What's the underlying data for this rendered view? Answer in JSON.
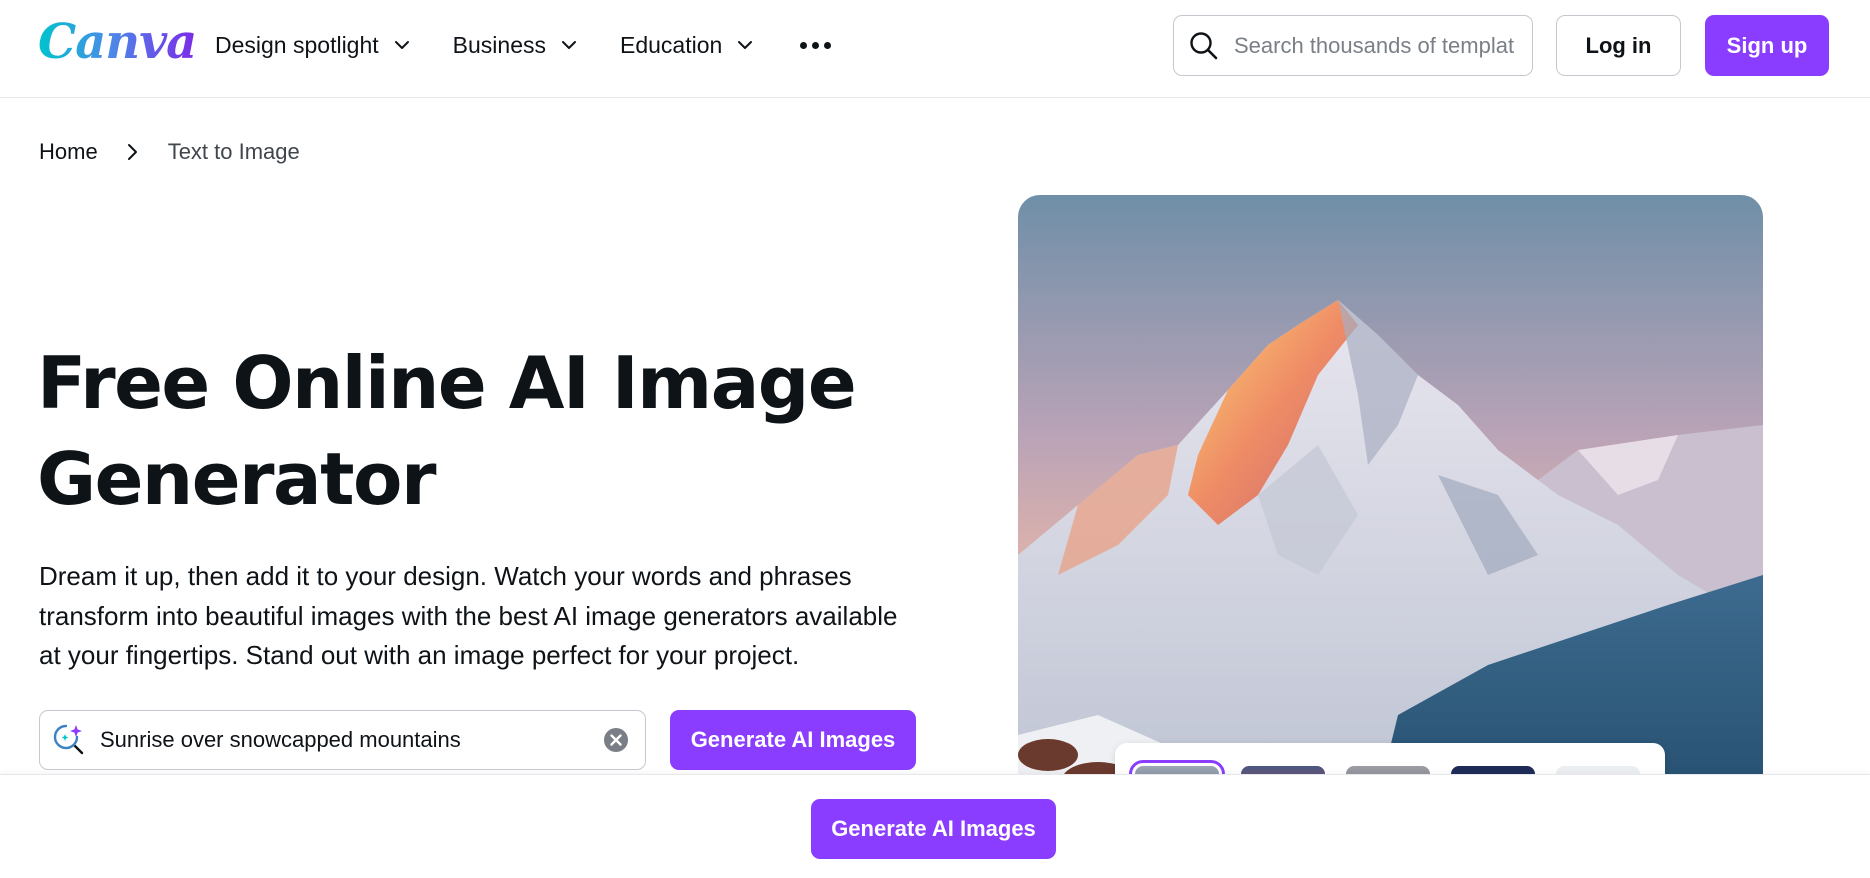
{
  "header": {
    "logo_text": "Canva",
    "nav": [
      {
        "label": "Design spotlight"
      },
      {
        "label": "Business"
      },
      {
        "label": "Education"
      }
    ],
    "search_placeholder": "Search thousands of templates",
    "login_label": "Log in",
    "signup_label": "Sign up"
  },
  "breadcrumb": {
    "home": "Home",
    "current": "Text to Image"
  },
  "hero": {
    "title": "Free Online AI Image Generator",
    "description": "Dream it up, then add it to your design. Watch your words and phrases transform into beautiful images with the best AI image generators available at your fingertips. Stand out with an image perfect for your project.",
    "prompt_value": "Sunrise over snowcapped mountains",
    "generate_label": "Generate AI Images"
  },
  "image_panel": {
    "thumbnails": [
      {
        "style": "selected",
        "color": "#7b8794"
      },
      {
        "style": "default",
        "color": "#c0506a"
      },
      {
        "style": "default",
        "color": "#8a8c93"
      },
      {
        "style": "default",
        "color": "#1e2a55"
      },
      {
        "style": "default",
        "color": "#eceff2"
      }
    ]
  },
  "bottom_bar": {
    "generate_label": "Generate AI Images"
  },
  "colors": {
    "accent": "#8b3dff",
    "text": "#0e1318",
    "border": "#c5c9cf"
  }
}
